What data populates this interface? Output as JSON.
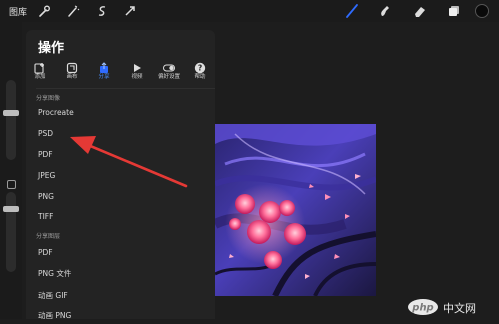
{
  "topbar": {
    "gallery_label": "图库",
    "left_tools": [
      "wrench-icon",
      "magic-wand-icon",
      "selection-s-icon",
      "transform-arrow-icon"
    ],
    "right_tools": [
      "brush-icon",
      "smudge-icon",
      "eraser-icon",
      "layers-icon",
      "color-swatch-icon"
    ],
    "accent": "#2f6bff"
  },
  "panel": {
    "title": "操作",
    "tabs": [
      {
        "label": "添加",
        "icon": "add-icon"
      },
      {
        "label": "画布",
        "icon": "canvas-icon"
      },
      {
        "label": "分享",
        "icon": "share-icon",
        "active": true
      },
      {
        "label": "视频",
        "icon": "video-play-icon"
      },
      {
        "label": "偏好设置",
        "icon": "toggle-icon"
      },
      {
        "label": "帮助",
        "icon": "help-icon"
      }
    ],
    "section_share_image": "分享图像",
    "image_formats": [
      "Procreate",
      "PSD",
      "PDF",
      "JPEG",
      "PNG",
      "TIFF"
    ],
    "section_share_layers": "分享图层",
    "layer_formats": [
      "PDF",
      "PNG 文件",
      "动画 GIF",
      "动画 PNG"
    ]
  },
  "watermark": {
    "text": "中文网",
    "brand": "php"
  },
  "colors": {
    "active_tab": "#4a90ff",
    "arrow": "#e53935",
    "panel_bg": "#232323"
  }
}
